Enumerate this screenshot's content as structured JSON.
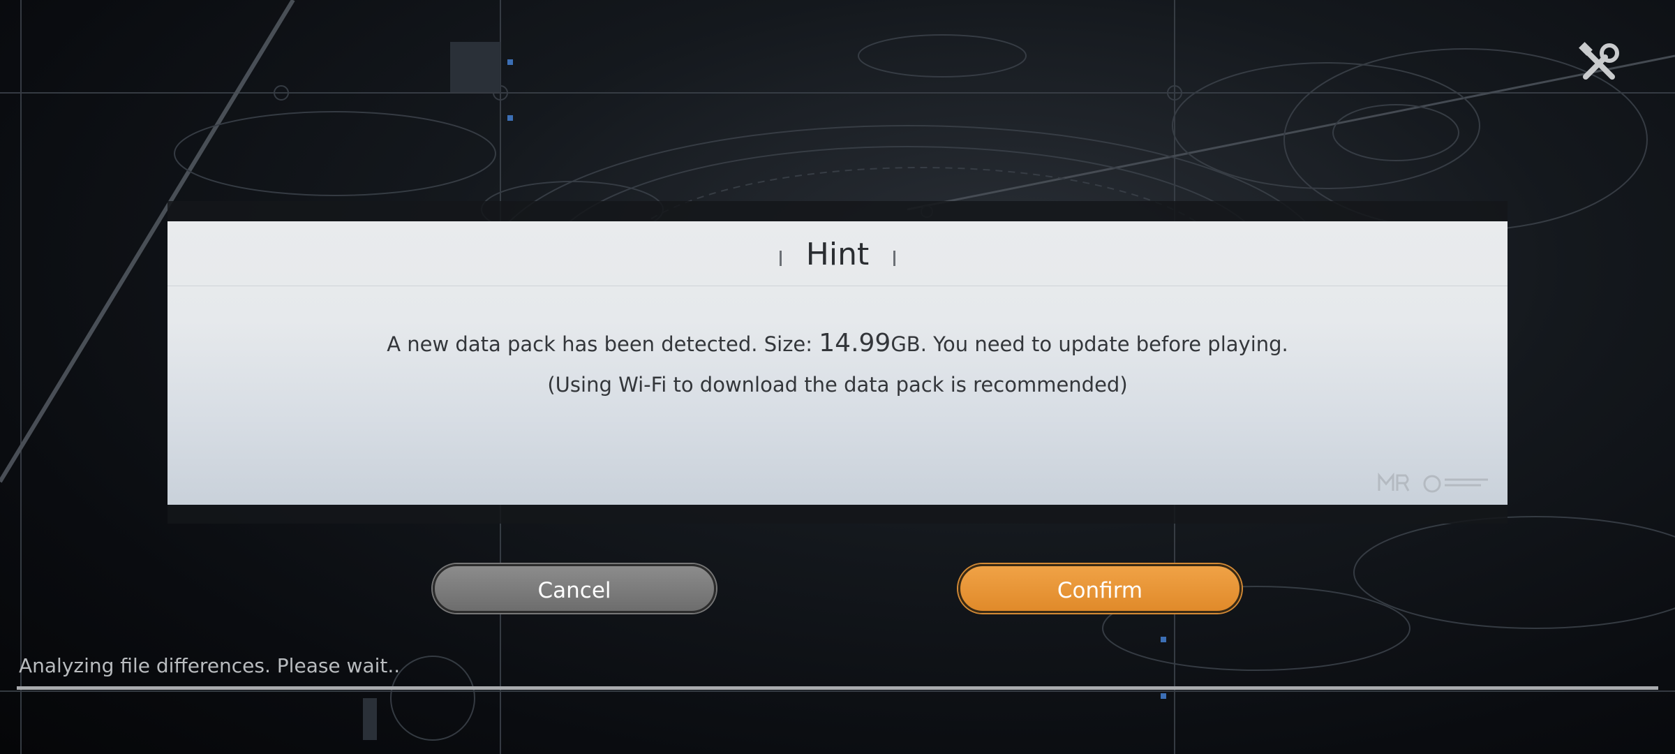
{
  "dialog": {
    "title": "Hint",
    "message_prefix": "A new data pack has been detected. Size: ",
    "size_value": "14.99",
    "message_suffix": "GB. You need to update before playing.",
    "message_line2": "(Using Wi-Fi to download the data pack is recommended)"
  },
  "buttons": {
    "cancel_label": "Cancel",
    "confirm_label": "Confirm"
  },
  "status": {
    "text": "Analyzing file differences. Please wait..",
    "progress": 1.0
  },
  "icons": {
    "settings": "tools-icon"
  },
  "colors": {
    "confirm": "#e8952f",
    "cancel": "#7a7a7a",
    "dialog_bg": "#e6e9ec"
  }
}
